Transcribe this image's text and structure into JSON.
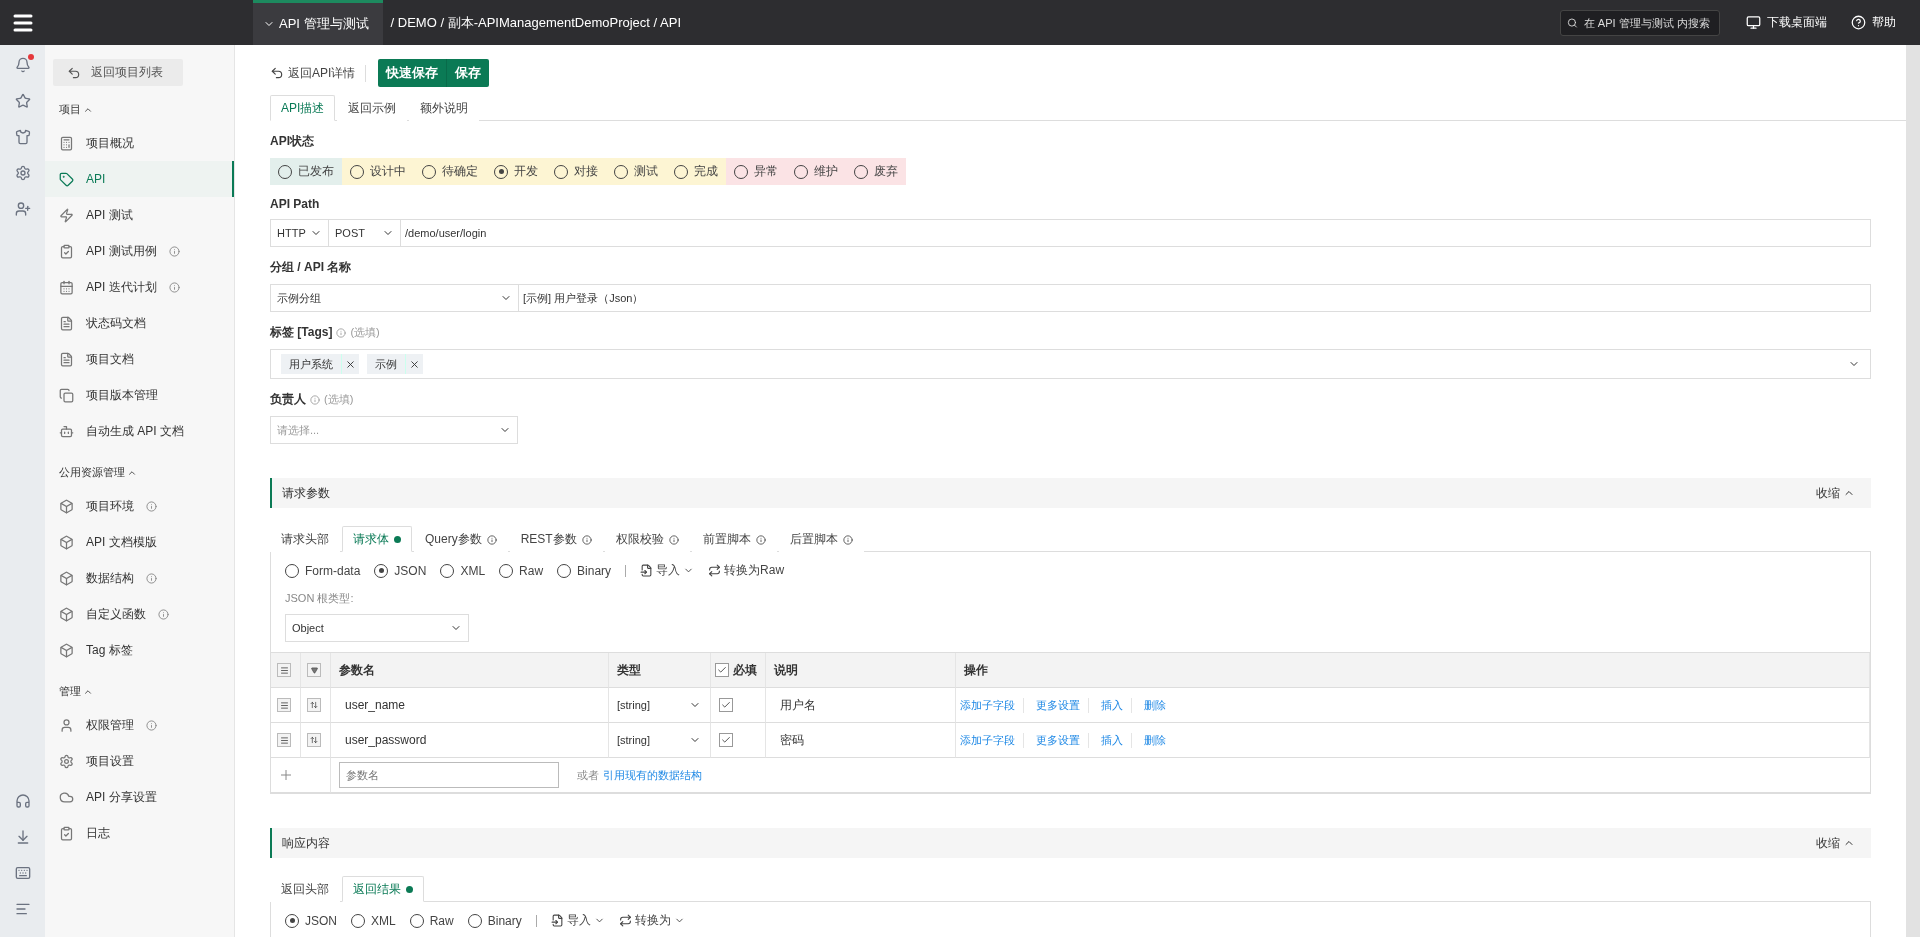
{
  "topbar": {
    "app_menu": "API 管理与测试",
    "breadcrumb": "/ DEMO / 副本-APIManagementDemoProject / API",
    "search": {
      "placeholder": "在 API 管理与测试 内搜索"
    },
    "download": "下载桌面端",
    "help": "帮助"
  },
  "rail": {
    "notification_badge": true
  },
  "sidebar": {
    "back": "返回项目列表",
    "groups": [
      {
        "title": "项目",
        "expanded": true,
        "items": [
          {
            "label": "项目概况",
            "selected": false,
            "info": false
          },
          {
            "label": "API",
            "selected": true,
            "info": false
          },
          {
            "label": "API 测试",
            "selected": false,
            "info": false
          },
          {
            "label": "API 测试用例",
            "selected": false,
            "info": true
          },
          {
            "label": "API 迭代计划",
            "selected": false,
            "info": true
          },
          {
            "label": "状态码文档",
            "selected": false,
            "info": false
          },
          {
            "label": "项目文档",
            "selected": false,
            "info": false
          },
          {
            "label": "项目版本管理",
            "selected": false,
            "info": false
          },
          {
            "label": "自动生成 API 文档",
            "selected": false,
            "info": false
          }
        ]
      },
      {
        "title": "公用资源管理",
        "expanded": true,
        "items": [
          {
            "label": "项目环境",
            "selected": false,
            "info": true
          },
          {
            "label": "API 文档模版",
            "selected": false,
            "info": false
          },
          {
            "label": "数据结构",
            "selected": false,
            "info": true
          },
          {
            "label": "自定义函数",
            "selected": false,
            "info": true
          },
          {
            "label": "Tag 标签",
            "selected": false,
            "info": false
          }
        ]
      },
      {
        "title": "管理",
        "expanded": true,
        "items": [
          {
            "label": "权限管理",
            "selected": false,
            "info": true
          },
          {
            "label": "项目设置",
            "selected": false,
            "info": false
          },
          {
            "label": "API 分享设置",
            "selected": false,
            "info": false
          },
          {
            "label": "日志",
            "selected": false,
            "info": false
          }
        ]
      }
    ]
  },
  "toolbar": {
    "back": "返回API详情",
    "buttons": [
      "快速保存",
      "保存"
    ]
  },
  "tabs": [
    {
      "label": "API描述",
      "selected": true
    },
    {
      "label": "返回示例",
      "selected": false
    },
    {
      "label": "额外说明",
      "selected": false
    }
  ],
  "status": {
    "label": "API状态",
    "options": [
      {
        "label": "已发布",
        "selected": false,
        "color": "#e3efec"
      },
      {
        "label": "设计中",
        "selected": false,
        "color": "#fdf5d3"
      },
      {
        "label": "待确定",
        "selected": false,
        "color": "#fdf5d3"
      },
      {
        "label": "开发",
        "selected": true,
        "color": "#fdf5d3"
      },
      {
        "label": "对接",
        "selected": false,
        "color": "#fdf5d3"
      },
      {
        "label": "测试",
        "selected": false,
        "color": "#fdf5d3"
      },
      {
        "label": "完成",
        "selected": false,
        "color": "#fdf5d3"
      },
      {
        "label": "异常",
        "selected": false,
        "color": "#fbe3e5"
      },
      {
        "label": "维护",
        "selected": false,
        "color": "#fbe3e5"
      },
      {
        "label": "废弃",
        "selected": false,
        "color": "#fbe3e5"
      }
    ]
  },
  "api_path": {
    "label": "API Path",
    "protocol": "HTTP",
    "method": "POST",
    "path": "/demo/user/login"
  },
  "group_name": {
    "label": "分组 / API 名称",
    "group": "示例分组",
    "name": "[示例] 用户登录（Json）"
  },
  "tags": {
    "label": "标签 [Tags]",
    "hint": "(选填)",
    "values": [
      "用户系统",
      "示例"
    ]
  },
  "owner": {
    "label": "负责人",
    "hint": "(选填)",
    "placeholder": "请选择..."
  },
  "request": {
    "title": "请求参数",
    "collapse": "收缩",
    "tabs": [
      {
        "label": "请求头部",
        "selected": false,
        "dot": false,
        "info": false
      },
      {
        "label": "请求体",
        "selected": true,
        "dot": true,
        "info": false
      },
      {
        "label": "Query参数",
        "selected": false,
        "dot": false,
        "info": true
      },
      {
        "label": "REST参数",
        "selected": false,
        "dot": false,
        "info": true
      },
      {
        "label": "权限校验",
        "selected": false,
        "dot": false,
        "info": true
      },
      {
        "label": "前置脚本",
        "selected": false,
        "dot": false,
        "info": true
      },
      {
        "label": "后置脚本",
        "selected": false,
        "dot": false,
        "info": true
      }
    ],
    "formats": [
      {
        "label": "Form-data",
        "selected": false
      },
      {
        "label": "JSON",
        "selected": true
      },
      {
        "label": "XML",
        "selected": false
      },
      {
        "label": "Raw",
        "selected": false
      },
      {
        "label": "Binary",
        "selected": false
      }
    ],
    "import": "导入",
    "convert": "转换为Raw",
    "root_label": "JSON 根类型:",
    "root_type": "Object",
    "columns": {
      "name": "参数名",
      "type": "类型",
      "required": "必填",
      "required_all": true,
      "desc": "说明",
      "actions": "操作"
    },
    "rows": [
      {
        "name": "user_name",
        "type": "[string]",
        "required": true,
        "desc": "用户名",
        "actions": [
          "添加子字段",
          "更多设置",
          "插入",
          "删除"
        ]
      },
      {
        "name": "user_password",
        "type": "[string]",
        "required": true,
        "desc": "密码",
        "actions": [
          "添加子字段",
          "更多设置",
          "插入",
          "删除"
        ]
      }
    ],
    "add_placeholder": "参数名",
    "or": "或者",
    "ref_link": "引用现有的数据结构"
  },
  "response": {
    "title": "响应内容",
    "collapse": "收缩",
    "tabs": [
      {
        "label": "返回头部",
        "selected": false,
        "dot": false
      },
      {
        "label": "返回结果",
        "selected": true,
        "dot": true
      }
    ],
    "formats": [
      {
        "label": "JSON",
        "selected": true
      },
      {
        "label": "XML",
        "selected": false
      },
      {
        "label": "Raw",
        "selected": false
      },
      {
        "label": "Binary",
        "selected": false
      }
    ],
    "import": "导入",
    "convert": "转换为"
  }
}
